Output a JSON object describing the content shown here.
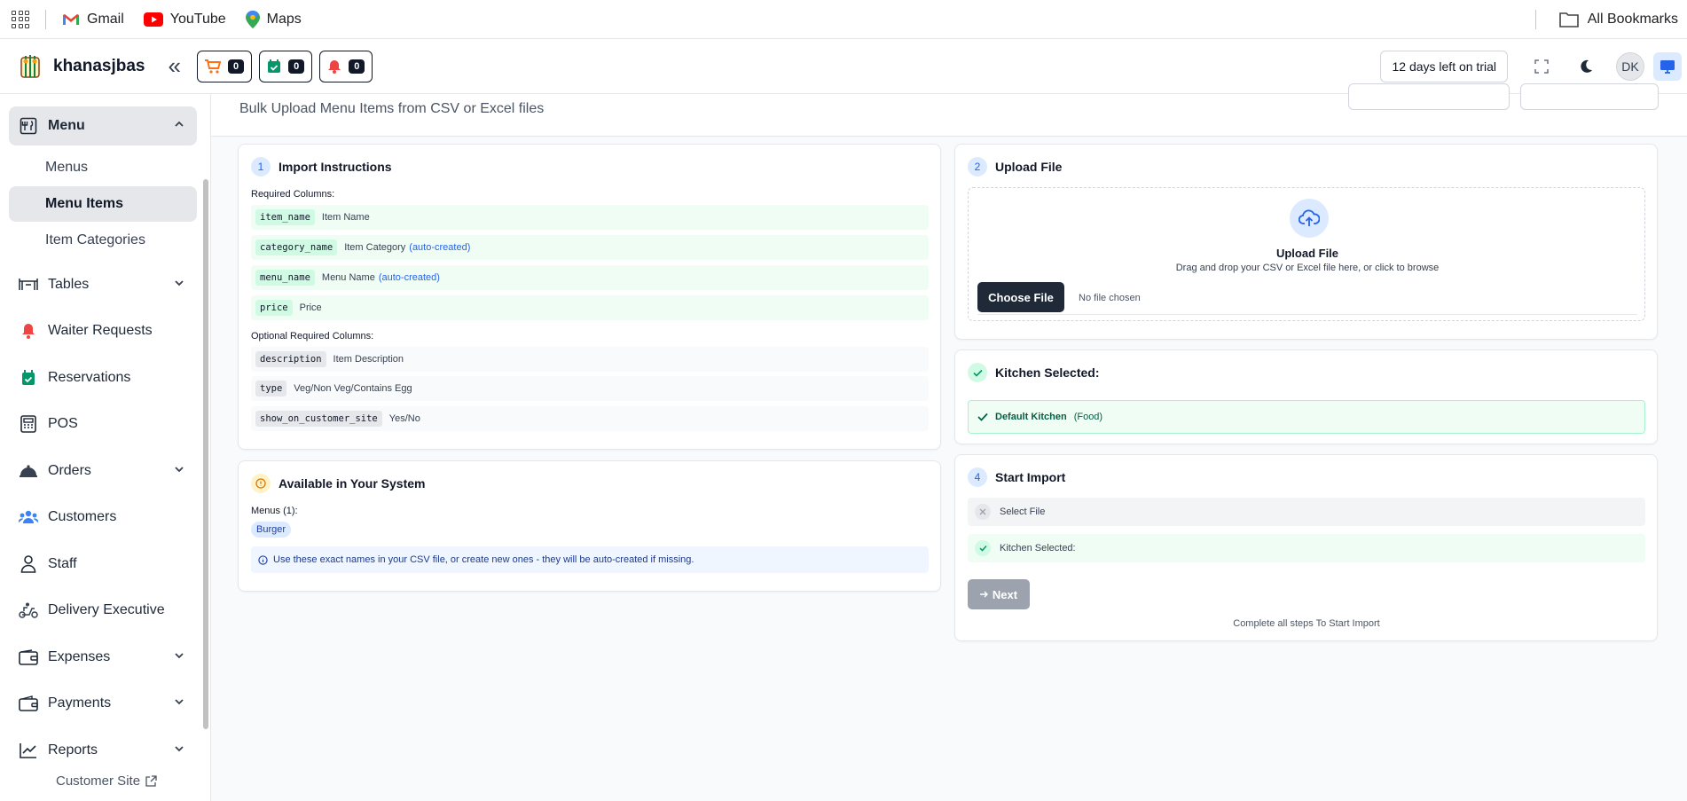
{
  "bookmarks": {
    "items": [
      {
        "label": "Gmail",
        "icon": "gmail-icon"
      },
      {
        "label": "YouTube",
        "icon": "youtube-icon"
      },
      {
        "label": "Maps",
        "icon": "maps-icon"
      }
    ],
    "all_bookmarks": "All Bookmarks"
  },
  "header": {
    "brand": "khanasjbas",
    "cart_count": "0",
    "calendar_count": "0",
    "bell_count": "0",
    "trial": "12 days left on trial",
    "avatar": "DK"
  },
  "sidebar": {
    "menu": "Menu",
    "menu_sub": [
      "Menus",
      "Menu Items",
      "Item Categories"
    ],
    "items": [
      "Tables",
      "Waiter Requests",
      "Reservations",
      "POS",
      "Orders",
      "Customers",
      "Staff",
      "Delivery Executive",
      "Expenses",
      "Payments",
      "Reports"
    ],
    "footer": "Customer Site"
  },
  "page": {
    "subtitle": "Bulk Upload Menu Items from CSV or Excel files"
  },
  "instructions": {
    "step": "1",
    "title": "Import Instructions",
    "required_label": "Required Columns:",
    "required": [
      {
        "key": "item_name",
        "desc": "Item Name",
        "note": ""
      },
      {
        "key": "category_name",
        "desc": "Item Category",
        "note": "(auto-created)"
      },
      {
        "key": "menu_name",
        "desc": "Menu Name",
        "note": "(auto-created)"
      },
      {
        "key": "price",
        "desc": "Price",
        "note": ""
      }
    ],
    "optional_label": "Optional Required Columns:",
    "optional": [
      {
        "key": "description",
        "desc": "Item Description"
      },
      {
        "key": "type",
        "desc": "Veg/Non Veg/Contains Egg"
      },
      {
        "key": "show_on_customer_site",
        "desc": "Yes/No"
      }
    ]
  },
  "available": {
    "title": "Available in Your System",
    "menus_label": "Menus (1):",
    "menus": [
      "Burger"
    ],
    "info": "Use these exact names in your CSV file, or create new ones - they will be auto-created if missing."
  },
  "upload": {
    "step": "2",
    "title": "Upload File",
    "zone_title": "Upload File",
    "zone_sub": "Drag and drop your CSV or Excel file here, or click to browse",
    "choose": "Choose File",
    "nofile": "No file chosen"
  },
  "kitchen": {
    "title": "Kitchen Selected:",
    "name": "Default Kitchen",
    "type": "(Food)"
  },
  "start": {
    "step": "4",
    "title": "Start Import",
    "select_file": "Select File",
    "kitchen_selected": "Kitchen Selected:",
    "next": "Next",
    "complete": "Complete all steps To Start Import"
  },
  "colors": {
    "accent": "#2563eb",
    "dark": "#1f2937",
    "success": "#059669",
    "bell": "#ef4444",
    "cart": "#f97316"
  }
}
